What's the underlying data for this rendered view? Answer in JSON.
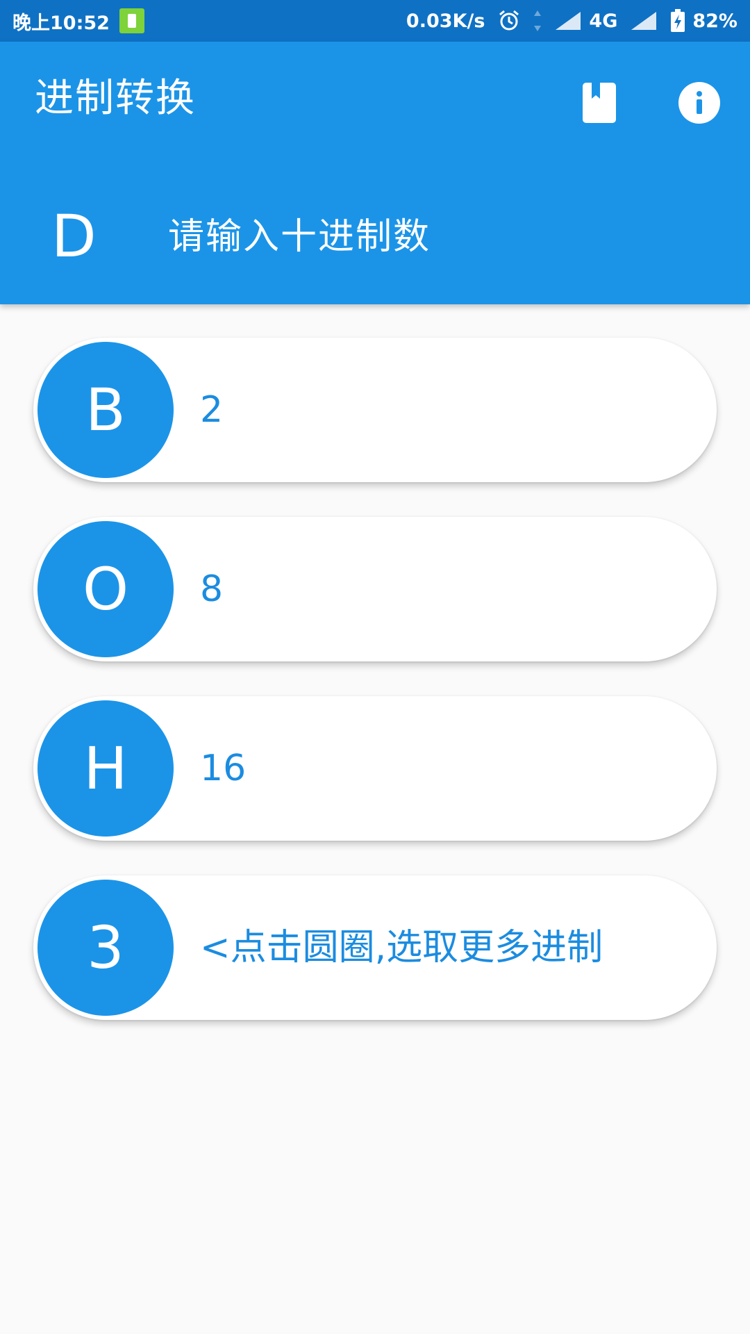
{
  "status_bar": {
    "time": "晚上10:52",
    "network_speed": "0.03K/s",
    "network_type": "4G",
    "battery": "82%"
  },
  "app_bar": {
    "title": "进制转换",
    "decimal_letter": "D",
    "decimal_placeholder": "请输入十进制数"
  },
  "bases": [
    {
      "letter": "B",
      "value": "2"
    },
    {
      "letter": "O",
      "value": "8"
    },
    {
      "letter": "H",
      "value": "16"
    },
    {
      "letter": "3",
      "value": "<点击圆圈,选取更多进制"
    }
  ],
  "colors": {
    "primary": "#1b94e8",
    "status_bar": "#0f71c4",
    "background": "#fafafa",
    "battery_saver": "#7ed23a"
  },
  "icons": [
    "battery-saver-icon",
    "alarm-icon",
    "data-arrows-icon",
    "signal-icon",
    "battery-icon",
    "bookmark-icon",
    "info-icon"
  ]
}
